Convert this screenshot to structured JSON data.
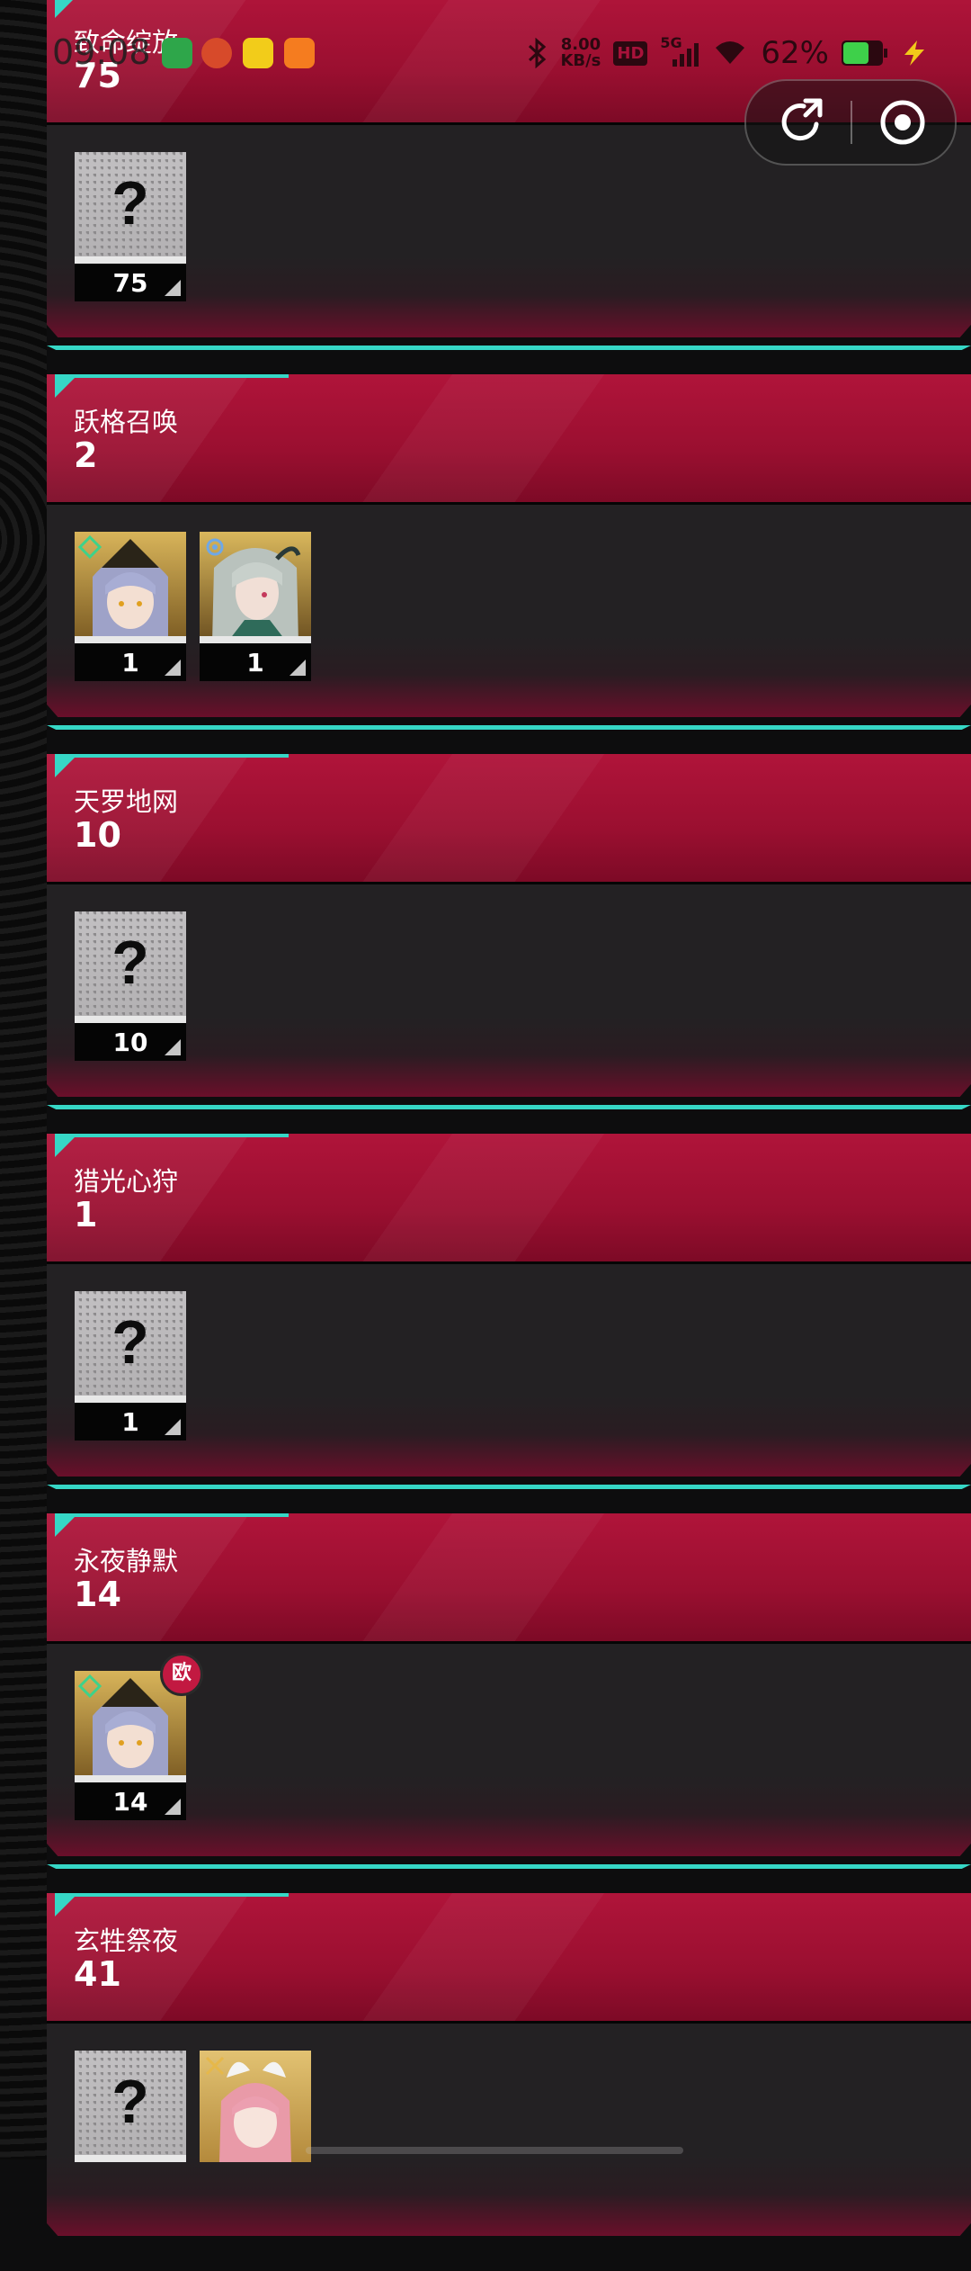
{
  "status_bar": {
    "time": "09:08",
    "network_speed_value": "8.00",
    "network_speed_unit": "KB/s",
    "hd_label": "HD",
    "signal_label": "5G",
    "battery_percent": "62%"
  },
  "capsule": {
    "share_icon": "share-arrow-icon",
    "close_icon": "target-close-icon"
  },
  "sections": [
    {
      "title": "致命绽放",
      "count": "75",
      "cards": [
        {
          "type": "unknown",
          "count": "75"
        }
      ]
    },
    {
      "title": "跃格召唤",
      "count": "2",
      "cards": [
        {
          "type": "character",
          "char": "gold-silver-hair",
          "count": "1"
        },
        {
          "type": "character",
          "char": "green-gray-hair",
          "count": "1"
        }
      ]
    },
    {
      "title": "天罗地网",
      "count": "10",
      "cards": [
        {
          "type": "unknown",
          "count": "10"
        }
      ]
    },
    {
      "title": "猎光心狩",
      "count": "1",
      "cards": [
        {
          "type": "unknown",
          "count": "1"
        }
      ]
    },
    {
      "title": "永夜静默",
      "count": "14",
      "cards": [
        {
          "type": "character",
          "char": "gold-silver-hair",
          "count": "14",
          "badge": "欧"
        }
      ]
    },
    {
      "title": "玄牲祭夜",
      "count": "41",
      "cards": [
        {
          "type": "unknown",
          "count": ""
        },
        {
          "type": "character",
          "char": "pink-hair",
          "count": ""
        }
      ]
    }
  ],
  "colors": {
    "banner": "#a8123a",
    "accent": "#36d7c6",
    "card_body": "#232123",
    "badge": "#c21941"
  }
}
